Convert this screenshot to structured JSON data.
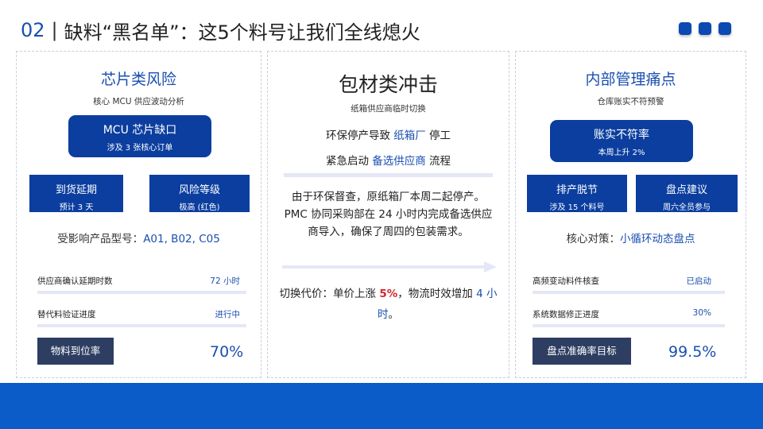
{
  "header": {
    "section_number": "02",
    "separator": "|",
    "title": "缺料“黑名单”：这5个料号让我们全线熄火"
  },
  "card1": {
    "title": "芯片类风险",
    "subtitle": "核心 MCU 供应波动分析",
    "highlight": {
      "title": "MCU 芯片缺口",
      "detail": "涉及 3 张核心订单"
    },
    "tiles": [
      {
        "title": "到货延期",
        "detail": "预计 3 天"
      },
      {
        "title": "风险等级",
        "detail": "极高 (红色)"
      }
    ],
    "affected_label": "受影响产品型号：",
    "affected_models": "A01, B02, C05",
    "rows": [
      {
        "label": "供应商确认延期时数",
        "value": "72 小时"
      },
      {
        "label": "替代料验证进度",
        "value": "进行中"
      }
    ],
    "stat": {
      "label": "物料到位率",
      "value": "70%"
    }
  },
  "card2": {
    "title": "包材类冲击",
    "subtitle": "纸箱供应商临时切换",
    "line1_prefix": "环保停产导致 ",
    "line1_accent": "纸箱厂",
    "line1_suffix": " 停工",
    "line2_prefix": "紧急启动 ",
    "line2_accent": "备选供应商",
    "line2_suffix": " 流程",
    "paragraph": "由于环保督查，原纸箱厂本周二起停产。PMC 协同采购部在 24 小时内完成备选供应商导入，确保了周四的包装需求。",
    "cost_prefix": "切换代价：单价上涨 ",
    "cost_pct": "5%",
    "cost_middle": "，物流时效增加 ",
    "cost_hours": "4 小时",
    "cost_end": "。"
  },
  "card3": {
    "title": "内部管理痛点",
    "subtitle": "仓库账实不符预警",
    "highlight": {
      "title": "账实不符率",
      "detail": "本周上升 2%"
    },
    "tiles": [
      {
        "title": "排产脱节",
        "detail": "涉及 15 个料号"
      },
      {
        "title": "盘点建议",
        "detail": "周六全员参与"
      }
    ],
    "strategy_label": "核心对策：",
    "strategy_value": "小循环动态盘点",
    "rows": [
      {
        "label": "高频变动料件核查",
        "value": "已启动"
      },
      {
        "label": "系统数据修正进度",
        "value": "30%"
      }
    ],
    "stat": {
      "label": "盘点准确率目标",
      "value": "99.5%"
    }
  },
  "colors": {
    "accent": "#1a4fb0",
    "dark_box": "#0b3e9f",
    "stat_box": "#2d3e62",
    "footer": "#0b5bc9",
    "cost_red": "#d0262e"
  }
}
